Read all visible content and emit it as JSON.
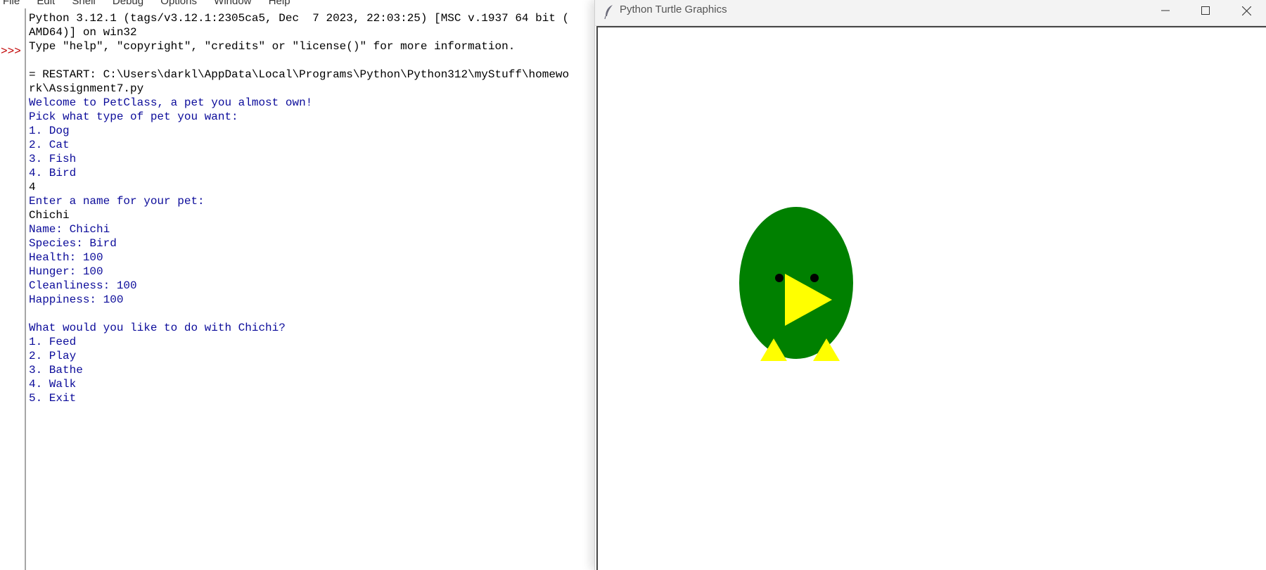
{
  "idle": {
    "menu": [
      "File",
      "Edit",
      "Shell",
      "Debug",
      "Options",
      "Window",
      "Help"
    ],
    "prompt": ">>>",
    "lines": [
      {
        "text": "Python 3.12.1 (tags/v3.12.1:2305ca5, Dec  7 2023, 22:03:25) [MSC v.1937 64 bit (",
        "kind": "out"
      },
      {
        "text": "AMD64)] on win32",
        "kind": "out"
      },
      {
        "text": "Type \"help\", \"copyright\", \"credits\" or \"license()\" for more information.",
        "kind": "out"
      },
      {
        "text": "",
        "kind": "out"
      },
      {
        "text": "= RESTART: C:\\Users\\darkl\\AppData\\Local\\Programs\\Python\\Python312\\myStuff\\homewo",
        "kind": "out"
      },
      {
        "text": "rk\\Assignment7.py",
        "kind": "out"
      },
      {
        "text": "Welcome to PetClass, a pet you almost own!",
        "kind": "usr"
      },
      {
        "text": "Pick what type of pet you want:",
        "kind": "usr"
      },
      {
        "text": "1. Dog",
        "kind": "usr"
      },
      {
        "text": "2. Cat",
        "kind": "usr"
      },
      {
        "text": "3. Fish",
        "kind": "usr"
      },
      {
        "text": "4. Bird",
        "kind": "usr"
      },
      {
        "text": "4",
        "kind": "inp"
      },
      {
        "text": "Enter a name for your pet:",
        "kind": "usr"
      },
      {
        "text": "Chichi",
        "kind": "inp"
      },
      {
        "text": "Name: Chichi",
        "kind": "usr"
      },
      {
        "text": "Species: Bird",
        "kind": "usr"
      },
      {
        "text": "Health: 100",
        "kind": "usr"
      },
      {
        "text": "Hunger: 100",
        "kind": "usr"
      },
      {
        "text": "Cleanliness: 100",
        "kind": "usr"
      },
      {
        "text": "Happiness: 100",
        "kind": "usr"
      },
      {
        "text": "",
        "kind": "usr"
      },
      {
        "text": "What would you like to do with Chichi?",
        "kind": "usr"
      },
      {
        "text": "1. Feed",
        "kind": "usr"
      },
      {
        "text": "2. Play",
        "kind": "usr"
      },
      {
        "text": "3. Bathe",
        "kind": "usr"
      },
      {
        "text": "4. Walk",
        "kind": "usr"
      },
      {
        "text": "5. Exit",
        "kind": "usr"
      }
    ],
    "colors": {
      "stdout": "#0b0b9a",
      "input": "#000000",
      "prompt": "#c00000"
    }
  },
  "turtle_window": {
    "title": "Python Turtle Graphics",
    "icons": [
      "feather-icon",
      "minimize-icon",
      "maximize-icon",
      "close-icon"
    ],
    "drawing": {
      "subject": "bird",
      "colors": {
        "body": "#008000",
        "beak": "#ffff00",
        "feet": "#ffff00",
        "eyes": "#000000",
        "crest": "#0000ff"
      }
    }
  }
}
